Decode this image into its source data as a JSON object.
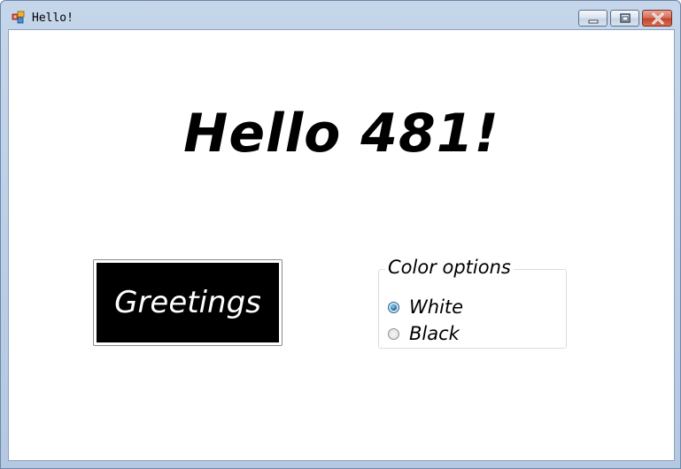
{
  "window": {
    "title": "Hello!",
    "icon": "winforms-app-icon",
    "controls": {
      "minimize": "minimize-icon",
      "maximize": "maximize-icon",
      "close": "close-icon"
    }
  },
  "main": {
    "heading": "Hello 481!",
    "greetings_button_label": "Greetings"
  },
  "color_options": {
    "legend": "Color options",
    "options": [
      {
        "label": "White",
        "checked": true
      },
      {
        "label": "Black",
        "checked": false
      }
    ]
  },
  "colors": {
    "titlebar": "#b9cde5",
    "button_face": "#000000",
    "button_text": "#ffffff",
    "close_button": "#c94a31"
  }
}
